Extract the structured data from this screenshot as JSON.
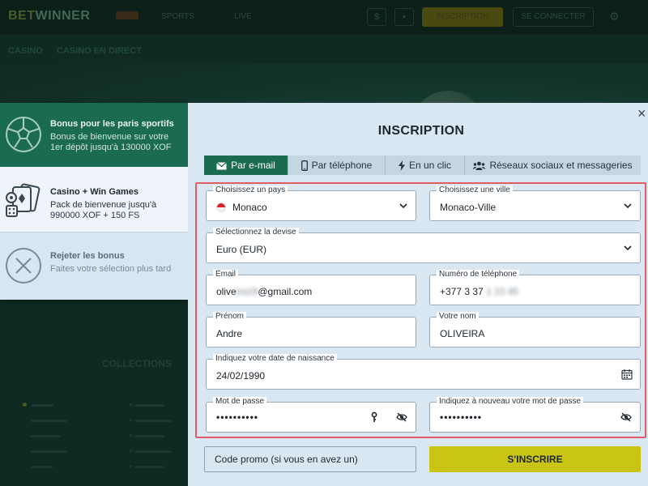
{
  "background_site": {
    "logo_part1": "BET",
    "logo_part2": "WINNER",
    "nav": [
      "SPORTS",
      "LIVE"
    ],
    "register_label": "INSCRIPTION",
    "login_label": "SE CONNECTER",
    "breadcrumbs": [
      "CASINO",
      "CASINO EN DIRECT"
    ],
    "collections_label": "COLLECTIONS"
  },
  "bonus_options": [
    {
      "title": "Bonus pour les paris sportifs",
      "description": "Bonus de bienvenue sur votre 1er dépôt jusqu'à 130000 XOF",
      "icon": "soccer-ball-icon"
    },
    {
      "title": "Casino + Win Games",
      "description": "Pack de bienvenue jusqu'à 990000 XOF + 150 FS",
      "icon": "cards-dice-icon"
    },
    {
      "title": "Rejeter les bonus",
      "description": "Faites votre sélection plus tard",
      "icon": "reject-x-icon"
    }
  ],
  "modal": {
    "title": "INSCRIPTION",
    "close_icon": "close-icon",
    "tabs": [
      {
        "label": "Par e-mail",
        "icon": "envelope-icon",
        "active": true
      },
      {
        "label": "Par téléphone",
        "icon": "phone-icon",
        "active": false
      },
      {
        "label": "En un clic",
        "icon": "lightning-icon",
        "active": false
      },
      {
        "label": "Réseaux sociaux et messageries",
        "icon": "users-icon",
        "active": false
      }
    ]
  },
  "form": {
    "country": {
      "label": "Choisissez un pays",
      "value": "Monaco"
    },
    "city": {
      "label": "Choisissez une ville",
      "value": "Monaco-Ville"
    },
    "currency": {
      "label": "Sélectionnez la devise",
      "value": "Euro (EUR)"
    },
    "email": {
      "label": "Email",
      "value_start": "olive",
      "value_hidden": "ira19",
      "value_end": "@gmail.com"
    },
    "phone": {
      "label": "Numéro de téléphone",
      "value_start": "+377 3 37",
      "value_hidden": "1 23 45"
    },
    "first_name": {
      "label": "Prénom",
      "value": "Andre"
    },
    "last_name": {
      "label": "Votre nom",
      "value": "OLIVEIRA"
    },
    "birth_date": {
      "label": "Indiquez votre date de naissance",
      "value": "24/02/1990"
    },
    "password": {
      "label": "Mot de passe",
      "value": "••••••••••"
    },
    "password_confirm": {
      "label": "Indiquez à nouveau votre mot de passe",
      "value": "••••••••••"
    },
    "promo_label": "Code promo (si vous en avez un)",
    "submit_label": "S'INSCRIRE"
  },
  "colors": {
    "accent_green": "#1b6b52",
    "submit_yellow": "#c9c515",
    "highlight_red": "#e05c67"
  }
}
